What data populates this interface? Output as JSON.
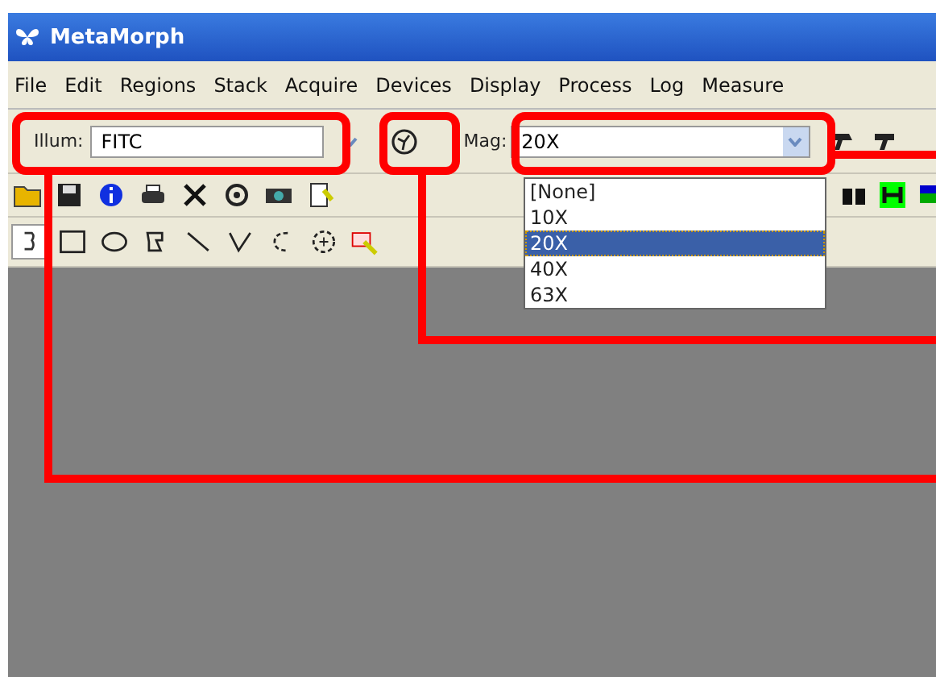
{
  "window": {
    "title": "MetaMorph"
  },
  "menu": [
    {
      "label": "File"
    },
    {
      "label": "Edit"
    },
    {
      "label": "Regions"
    },
    {
      "label": "Stack"
    },
    {
      "label": "Acquire"
    },
    {
      "label": "Devices"
    },
    {
      "label": "Display"
    },
    {
      "label": "Process"
    },
    {
      "label": "Log"
    },
    {
      "label": "Measure"
    }
  ],
  "illumination": {
    "label": "Illum:",
    "value": "FITC"
  },
  "magnification": {
    "label": "Mag:",
    "value": "20X",
    "options": [
      {
        "label": "[None]",
        "selected": false
      },
      {
        "label": "10X",
        "selected": false
      },
      {
        "label": "20X",
        "selected": true
      },
      {
        "label": "40X",
        "selected": false
      },
      {
        "label": "63X",
        "selected": false
      }
    ]
  }
}
